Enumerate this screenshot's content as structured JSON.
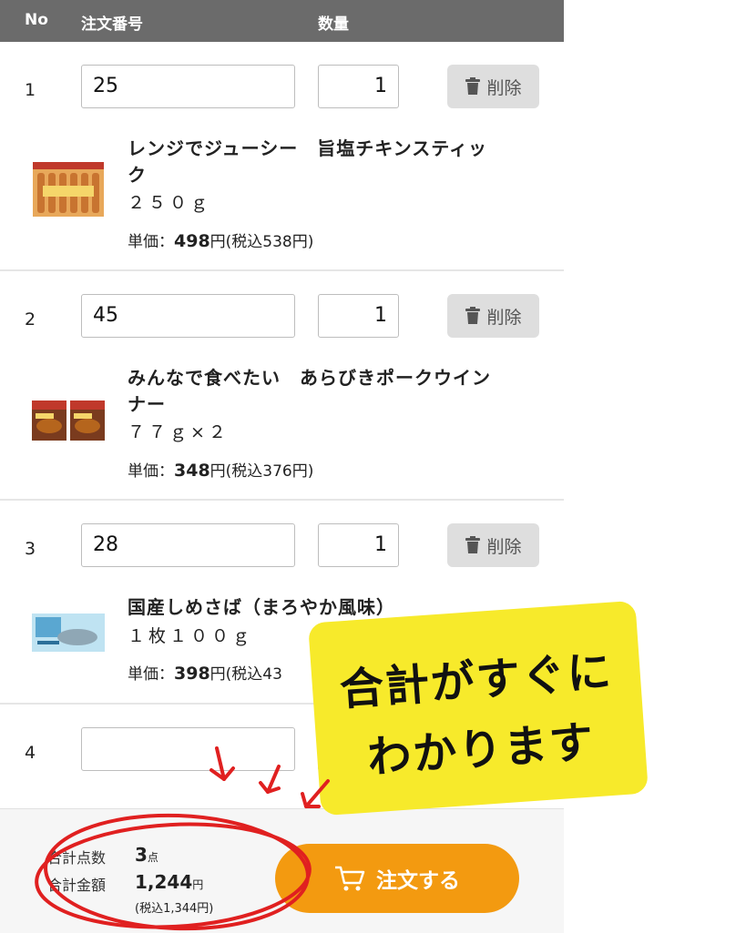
{
  "header": {
    "no": "No",
    "order_no": "注文番号",
    "qty": "数量"
  },
  "delete_label": "削除",
  "price_label": "単価：",
  "rows": [
    {
      "no": "1",
      "order_no": "25",
      "qty": "1",
      "name_line1": "レンジでジューシー　旨塩チキンスティッ",
      "name_line2": "ク",
      "desc": "２５０ｇ",
      "price": "498",
      "price_tax": "円(税込538円)"
    },
    {
      "no": "2",
      "order_no": "45",
      "qty": "1",
      "name_line1": "みんなで食べたい　あらびきポークウイン",
      "name_line2": "ナー",
      "desc": "７７ｇ×２",
      "price": "348",
      "price_tax": "円(税込376円)"
    },
    {
      "no": "3",
      "order_no": "28",
      "qty": "1",
      "name_line1": "国産しめさば（まろやか風味）",
      "desc": "１枚１００ｇ",
      "price": "398",
      "price_tax": "円(税込43"
    },
    {
      "no": "4",
      "order_no": "",
      "qty": ""
    }
  ],
  "footer": {
    "total_count_label": "合計点数",
    "total_count": "3",
    "total_count_unit": "点",
    "total_amount_label": "合計金額",
    "total_amount": "1,244",
    "total_amount_unit": "円",
    "total_tax": "(税込1,344円)",
    "order_button": "注文する"
  },
  "annotation": {
    "line1": "合計がすぐに",
    "line2": "わかります"
  },
  "colors": {
    "header_bg": "#6b6b6b",
    "order_button": "#f39a10",
    "callout": "#f7ea2b",
    "annotation_red": "#e02020"
  },
  "icons": [
    "trash-icon",
    "cart-icon"
  ]
}
